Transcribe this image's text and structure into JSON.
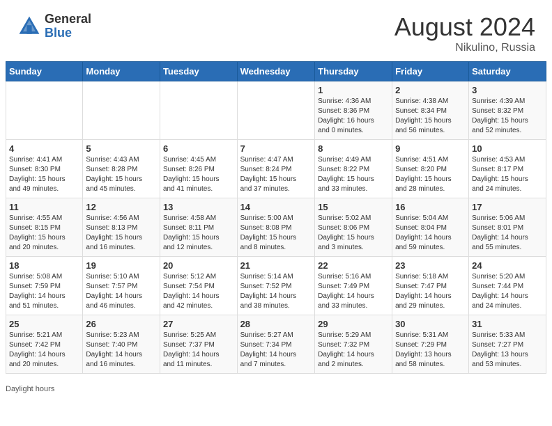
{
  "header": {
    "logo": {
      "general": "General",
      "blue": "Blue"
    },
    "title": "August 2024",
    "location": "Nikulino, Russia"
  },
  "days_of_week": [
    "Sunday",
    "Monday",
    "Tuesday",
    "Wednesday",
    "Thursday",
    "Friday",
    "Saturday"
  ],
  "weeks": [
    [
      {
        "day": "",
        "info": ""
      },
      {
        "day": "",
        "info": ""
      },
      {
        "day": "",
        "info": ""
      },
      {
        "day": "",
        "info": ""
      },
      {
        "day": "1",
        "info": "Sunrise: 4:36 AM\nSunset: 8:36 PM\nDaylight: 16 hours\nand 0 minutes."
      },
      {
        "day": "2",
        "info": "Sunrise: 4:38 AM\nSunset: 8:34 PM\nDaylight: 15 hours\nand 56 minutes."
      },
      {
        "day": "3",
        "info": "Sunrise: 4:39 AM\nSunset: 8:32 PM\nDaylight: 15 hours\nand 52 minutes."
      }
    ],
    [
      {
        "day": "4",
        "info": "Sunrise: 4:41 AM\nSunset: 8:30 PM\nDaylight: 15 hours\nand 49 minutes."
      },
      {
        "day": "5",
        "info": "Sunrise: 4:43 AM\nSunset: 8:28 PM\nDaylight: 15 hours\nand 45 minutes."
      },
      {
        "day": "6",
        "info": "Sunrise: 4:45 AM\nSunset: 8:26 PM\nDaylight: 15 hours\nand 41 minutes."
      },
      {
        "day": "7",
        "info": "Sunrise: 4:47 AM\nSunset: 8:24 PM\nDaylight: 15 hours\nand 37 minutes."
      },
      {
        "day": "8",
        "info": "Sunrise: 4:49 AM\nSunset: 8:22 PM\nDaylight: 15 hours\nand 33 minutes."
      },
      {
        "day": "9",
        "info": "Sunrise: 4:51 AM\nSunset: 8:20 PM\nDaylight: 15 hours\nand 28 minutes."
      },
      {
        "day": "10",
        "info": "Sunrise: 4:53 AM\nSunset: 8:17 PM\nDaylight: 15 hours\nand 24 minutes."
      }
    ],
    [
      {
        "day": "11",
        "info": "Sunrise: 4:55 AM\nSunset: 8:15 PM\nDaylight: 15 hours\nand 20 minutes."
      },
      {
        "day": "12",
        "info": "Sunrise: 4:56 AM\nSunset: 8:13 PM\nDaylight: 15 hours\nand 16 minutes."
      },
      {
        "day": "13",
        "info": "Sunrise: 4:58 AM\nSunset: 8:11 PM\nDaylight: 15 hours\nand 12 minutes."
      },
      {
        "day": "14",
        "info": "Sunrise: 5:00 AM\nSunset: 8:08 PM\nDaylight: 15 hours\nand 8 minutes."
      },
      {
        "day": "15",
        "info": "Sunrise: 5:02 AM\nSunset: 8:06 PM\nDaylight: 15 hours\nand 3 minutes."
      },
      {
        "day": "16",
        "info": "Sunrise: 5:04 AM\nSunset: 8:04 PM\nDaylight: 14 hours\nand 59 minutes."
      },
      {
        "day": "17",
        "info": "Sunrise: 5:06 AM\nSunset: 8:01 PM\nDaylight: 14 hours\nand 55 minutes."
      }
    ],
    [
      {
        "day": "18",
        "info": "Sunrise: 5:08 AM\nSunset: 7:59 PM\nDaylight: 14 hours\nand 51 minutes."
      },
      {
        "day": "19",
        "info": "Sunrise: 5:10 AM\nSunset: 7:57 PM\nDaylight: 14 hours\nand 46 minutes."
      },
      {
        "day": "20",
        "info": "Sunrise: 5:12 AM\nSunset: 7:54 PM\nDaylight: 14 hours\nand 42 minutes."
      },
      {
        "day": "21",
        "info": "Sunrise: 5:14 AM\nSunset: 7:52 PM\nDaylight: 14 hours\nand 38 minutes."
      },
      {
        "day": "22",
        "info": "Sunrise: 5:16 AM\nSunset: 7:49 PM\nDaylight: 14 hours\nand 33 minutes."
      },
      {
        "day": "23",
        "info": "Sunrise: 5:18 AM\nSunset: 7:47 PM\nDaylight: 14 hours\nand 29 minutes."
      },
      {
        "day": "24",
        "info": "Sunrise: 5:20 AM\nSunset: 7:44 PM\nDaylight: 14 hours\nand 24 minutes."
      }
    ],
    [
      {
        "day": "25",
        "info": "Sunrise: 5:21 AM\nSunset: 7:42 PM\nDaylight: 14 hours\nand 20 minutes."
      },
      {
        "day": "26",
        "info": "Sunrise: 5:23 AM\nSunset: 7:40 PM\nDaylight: 14 hours\nand 16 minutes."
      },
      {
        "day": "27",
        "info": "Sunrise: 5:25 AM\nSunset: 7:37 PM\nDaylight: 14 hours\nand 11 minutes."
      },
      {
        "day": "28",
        "info": "Sunrise: 5:27 AM\nSunset: 7:34 PM\nDaylight: 14 hours\nand 7 minutes."
      },
      {
        "day": "29",
        "info": "Sunrise: 5:29 AM\nSunset: 7:32 PM\nDaylight: 14 hours\nand 2 minutes."
      },
      {
        "day": "30",
        "info": "Sunrise: 5:31 AM\nSunset: 7:29 PM\nDaylight: 13 hours\nand 58 minutes."
      },
      {
        "day": "31",
        "info": "Sunrise: 5:33 AM\nSunset: 7:27 PM\nDaylight: 13 hours\nand 53 minutes."
      }
    ]
  ],
  "footer": {
    "daylight_label": "Daylight hours"
  }
}
